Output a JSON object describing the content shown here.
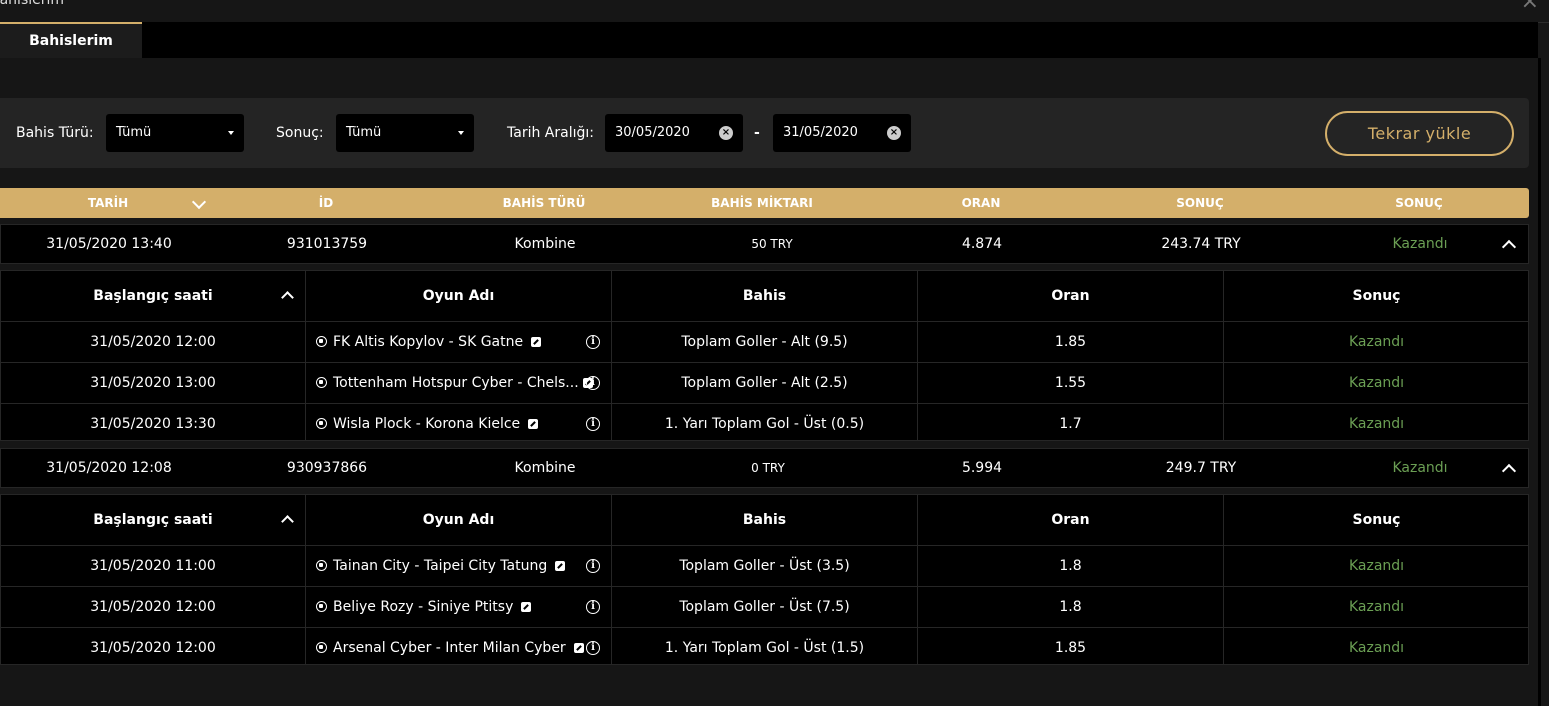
{
  "window": {
    "title": "Bahislerim",
    "close_icon": "close-icon"
  },
  "tabs": [
    {
      "label": "Bahislerim",
      "active": true
    }
  ],
  "filters": {
    "bet_type_label": "Bahis Türü:",
    "bet_type_value": "Tümü",
    "result_label": "Sonuç:",
    "result_value": "Tümü",
    "date_range_label": "Tarih Aralığı:",
    "date_from": "30/05/2020",
    "date_to": "31/05/2020",
    "reload_label": "Tekrar yükle"
  },
  "columns": [
    "TARİH",
    "İD",
    "BAHİS TÜRÜ",
    "BAHİS MİKTARI",
    "ORAN",
    "SONUÇ",
    "SONUÇ"
  ],
  "sub_columns": [
    "Başlangıç saati",
    "Oyun Adı",
    "Bahis",
    "Oran",
    "Sonuç"
  ],
  "bets": [
    {
      "date": "31/05/2020 13:40",
      "id": "931013759",
      "type": "Kombine",
      "amount": "50 TRY",
      "odds": "4.874",
      "payout": "243.74 TRY",
      "status": "Kazandı",
      "selections": [
        {
          "start": "31/05/2020 12:00",
          "game": "FK Altis Kopylov - SK Gatne",
          "bet": "Toplam Goller - Alt (9.5)",
          "odds": "1.85",
          "result": "Kazandı"
        },
        {
          "start": "31/05/2020 13:00",
          "game": "Tottenham Hotspur Cyber - Chels...",
          "bet": "Toplam Goller - Alt (2.5)",
          "odds": "1.55",
          "result": "Kazandı"
        },
        {
          "start": "31/05/2020 13:30",
          "game": "Wisla Plock - Korona Kielce",
          "bet": "1. Yarı Toplam Gol - Üst (0.5)",
          "odds": "1.7",
          "result": "Kazandı"
        }
      ]
    },
    {
      "date": "31/05/2020 12:08",
      "id": "930937866",
      "type": "Kombine",
      "amount": "0 TRY",
      "odds": "5.994",
      "payout": "249.7 TRY",
      "status": "Kazandı",
      "selections": [
        {
          "start": "31/05/2020 11:00",
          "game": "Tainan City - Taipei City Tatung",
          "bet": "Toplam Goller - Üst (3.5)",
          "odds": "1.8",
          "result": "Kazandı"
        },
        {
          "start": "31/05/2020 12:00",
          "game": "Beliye Rozy - Siniye Ptitsy",
          "bet": "Toplam Goller - Üst (7.5)",
          "odds": "1.8",
          "result": "Kazandı"
        },
        {
          "start": "31/05/2020 12:00",
          "game": "Arsenal Cyber - Inter Milan Cyber",
          "bet": "1. Yarı Toplam Gol - Üst (1.5)",
          "odds": "1.85",
          "result": "Kazandı"
        }
      ]
    }
  ],
  "colors": {
    "accent": "#d4af6a",
    "win": "#6b9f54",
    "background": "#161616",
    "row": "#000000"
  }
}
